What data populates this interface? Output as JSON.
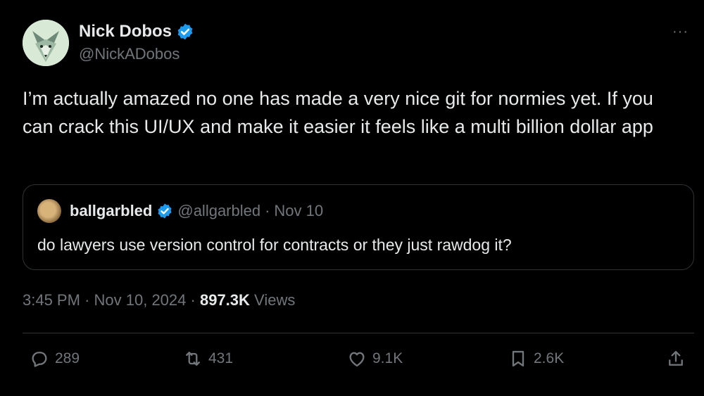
{
  "author": {
    "name": "Nick Dobos",
    "handle": "@NickADobos",
    "verified_icon": "verified-badge-icon"
  },
  "more_label": "···",
  "tweet": {
    "text": "I’m actually amazed no one has made a very nice git for normies yet. If you can crack this UI/UX and make it easier it feels like a multi billion dollar app"
  },
  "quote": {
    "name": "ballgarbled",
    "handle": "@allgarbled",
    "separator": "·",
    "date": "Nov 10",
    "text": "do lawyers use version control for contracts or they just rawdog it?"
  },
  "meta": {
    "time": "3:45 PM",
    "sep1": "·",
    "date": "Nov 10, 2024",
    "sep2": "·",
    "views_count": "897.3K",
    "views_label": "Views"
  },
  "actions": {
    "replies": "289",
    "reposts": "431",
    "likes": "9.1K",
    "bookmarks": "2.6K"
  },
  "colors": {
    "background": "#000000",
    "text": "#e7e9ea",
    "muted": "#71767b",
    "border": "#2f3336",
    "verified": "#1d9bf0"
  }
}
